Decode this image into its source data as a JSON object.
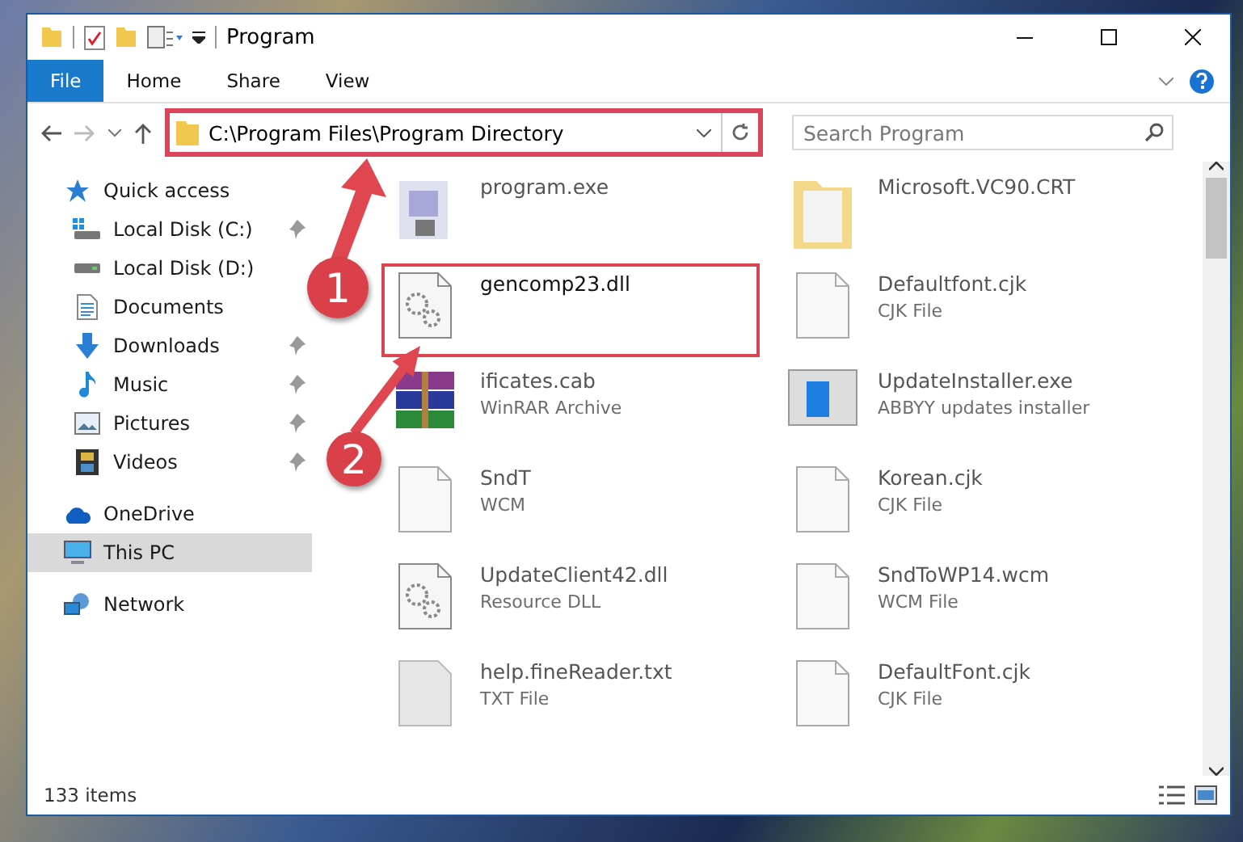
{
  "window": {
    "title": "Program"
  },
  "ribbon": [
    {
      "label": "File",
      "kind": "menu"
    },
    {
      "label": "Home",
      "kind": "tab"
    },
    {
      "label": "Share",
      "kind": "tab"
    },
    {
      "label": "View",
      "kind": "tab"
    }
  ],
  "address": {
    "path": "C:\\Program Files\\Program Directory",
    "highlighted": true
  },
  "search": {
    "placeholder": "Search Program"
  },
  "navigation": [
    {
      "label": "Quick access",
      "selected": false,
      "children": [
        {
          "label": "Local Disk (C:)",
          "pinned": true,
          "selected": false
        },
        {
          "label": "Local Disk (D:)",
          "pinned": false,
          "selected": false
        },
        {
          "label": "Documents",
          "pinned": false,
          "selected": false
        },
        {
          "label": "Downloads",
          "pinned": true,
          "selected": false
        },
        {
          "label": "Music",
          "pinned": true,
          "selected": false
        },
        {
          "label": "Pictures",
          "pinned": true,
          "selected": false
        },
        {
          "label": "Videos",
          "pinned": true,
          "selected": false
        }
      ]
    },
    {
      "label": "OneDrive",
      "selected": false
    },
    {
      "label": "This PC",
      "selected": true
    },
    {
      "label": "Network",
      "selected": false
    }
  ],
  "files": [
    {
      "name": "program.exe",
      "highlighted": false
    },
    {
      "name": "Microsoft.VC90.CRT",
      "highlighted": false
    },
    {
      "name": "gencomp23.dll",
      "highlighted": true
    },
    {
      "name": "Defaultfont.cjk",
      "type": "CJK File",
      "highlighted": false
    },
    {
      "name": "ificates.cab",
      "type": "WinRAR Archive",
      "highlighted": false
    },
    {
      "name": "UpdateInstaller.exe",
      "type": "ABBYY updates installer",
      "highlighted": false
    },
    {
      "name": "SndT",
      "type": "WCM",
      "highlighted": false
    },
    {
      "name": "Korean.cjk",
      "type": "CJK File",
      "highlighted": false
    },
    {
      "name": "UpdateClient42.dll",
      "type": "Resource DLL",
      "highlighted": false
    },
    {
      "name": "SndToWP14.wcm",
      "type": "WCM File",
      "highlighted": false
    },
    {
      "name": "help.fineReader.txt",
      "type": "TXT File",
      "highlighted": false
    },
    {
      "name": "DefaultFont.cjk",
      "type": "CJK File",
      "highlighted": false
    }
  ],
  "status_bar": {
    "count": "133 items"
  },
  "callouts": [
    {
      "label": "1"
    },
    {
      "label": "2"
    }
  ]
}
